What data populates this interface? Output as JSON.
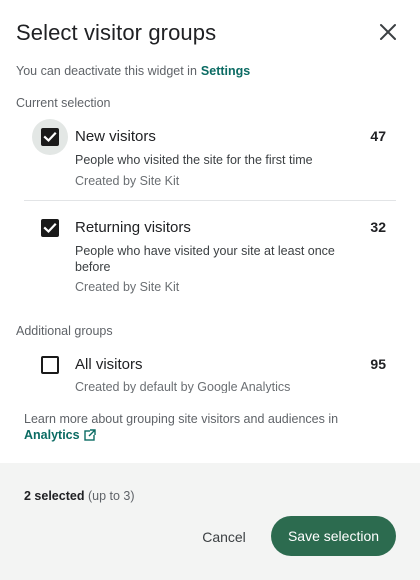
{
  "dialog": {
    "title": "Select visitor groups",
    "close_icon": "close-icon",
    "subtitle_text": "You can deactivate this widget in",
    "subtitle_link": "Settings"
  },
  "current_section": {
    "label": "Current selection",
    "items": [
      {
        "title": "New visitors",
        "description": "People who visited the site for the first time",
        "meta": "Created by Site Kit",
        "count": "47",
        "checked": true
      },
      {
        "title": "Returning visitors",
        "description": "People who have visited your site at least once before",
        "meta": "Created by Site Kit",
        "count": "32",
        "checked": true
      }
    ]
  },
  "additional_section": {
    "label": "Additional groups",
    "items": [
      {
        "title": "All visitors",
        "meta": "Created by default by Google Analytics",
        "count": "95",
        "checked": false
      }
    ]
  },
  "learn_more": {
    "text": "Learn more about grouping site visitors and audiences in",
    "link": "Analytics",
    "link_icon": "external-link-icon"
  },
  "footer": {
    "selected_text": "2 selected",
    "limit_text": "(up to 3)",
    "cancel_label": "Cancel",
    "save_label": "Save selection"
  },
  "colors": {
    "accent_link": "#0b6b63",
    "save_button": "#2c6b4f",
    "checkbox": "#1a1a1a",
    "footer_bg": "#f3f4f3"
  }
}
